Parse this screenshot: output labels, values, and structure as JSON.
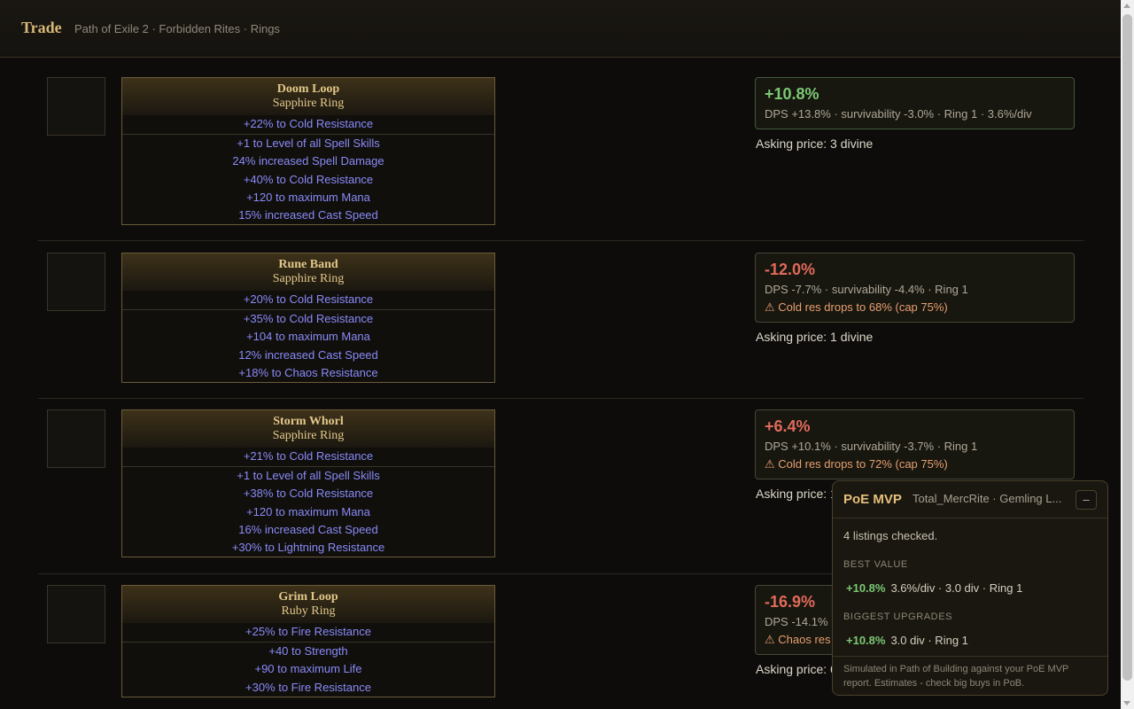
{
  "header": {
    "title": "Trade",
    "breadcrumb": "Path of Exile 2 · Forbidden Rites · Rings"
  },
  "listings": [
    {
      "name": "Doom Loop",
      "base": "Sapphire Ring",
      "implicit": "+22% to Cold Resistance",
      "mods": [
        "+1 to Level of all Spell Skills",
        "24% increased Spell Damage",
        "+40% to Cold Resistance",
        "+120 to maximum Mana",
        "15% increased Cast Speed"
      ],
      "score": "+10.8%",
      "detail": "DPS +13.8% · survivability -3.0% · Ring 1 · 3.6%/div",
      "warning": "",
      "price": "Asking price: 3 divine"
    },
    {
      "name": "Rune Band",
      "base": "Sapphire Ring",
      "implicit": "+20% to Cold Resistance",
      "mods": [
        "+35% to Cold Resistance",
        "+104 to maximum Mana",
        "12% increased Cast Speed",
        "+18% to Chaos Resistance"
      ],
      "score": "-12.0%",
      "detail": "DPS -7.7% · survivability -4.4% · Ring 1",
      "warning": "⚠ Cold res drops to 68% (cap 75%)",
      "price": "Asking price: 1 divine"
    },
    {
      "name": "Storm Whorl",
      "base": "Sapphire Ring",
      "implicit": "+21% to Cold Resistance",
      "mods": [
        "+1 to Level of all Spell Skills",
        "+38% to Cold Resistance",
        "+120 to maximum Mana",
        "16% increased Cast Speed",
        "+30% to Lightning Resistance"
      ],
      "score": "+6.4%",
      "detail": "DPS +10.1% · survivability -3.7% · Ring 1",
      "warning": "⚠ Cold res drops to 72% (cap 75%)",
      "price": "Asking price: 1"
    },
    {
      "name": "Grim Loop",
      "base": "Ruby Ring",
      "implicit": "+25% to Fire Resistance",
      "mods": [
        "+40 to Strength",
        "+90 to maximum Life",
        "+30% to Fire Resistance"
      ],
      "score": "-16.9%",
      "detail": "DPS -14.1%",
      "warning": "⚠ Chaos res",
      "price": "Asking price: 6"
    }
  ],
  "popup": {
    "brand": "PoE MVP",
    "context": "Total_MercRite · Gemling L...",
    "minimize_label": "–",
    "checked": "4 listings checked.",
    "best_value_heading": "BEST VALUE",
    "best_value": {
      "pct": "+10.8%",
      "text": "3.6%/div · 3.0 div · Ring 1"
    },
    "biggest_heading": "BIGGEST UPGRADES",
    "biggest": {
      "pct": "+10.8%",
      "text": "3.0 div · Ring 1"
    },
    "footer": "Simulated in Path of Building against your PoE MVP report. Estimates - check big buys in PoB."
  },
  "colors": {
    "positive": "#7cc874",
    "negative": "#e06a5a",
    "accent": "#d8b878",
    "mod_text": "#8a8af8"
  }
}
